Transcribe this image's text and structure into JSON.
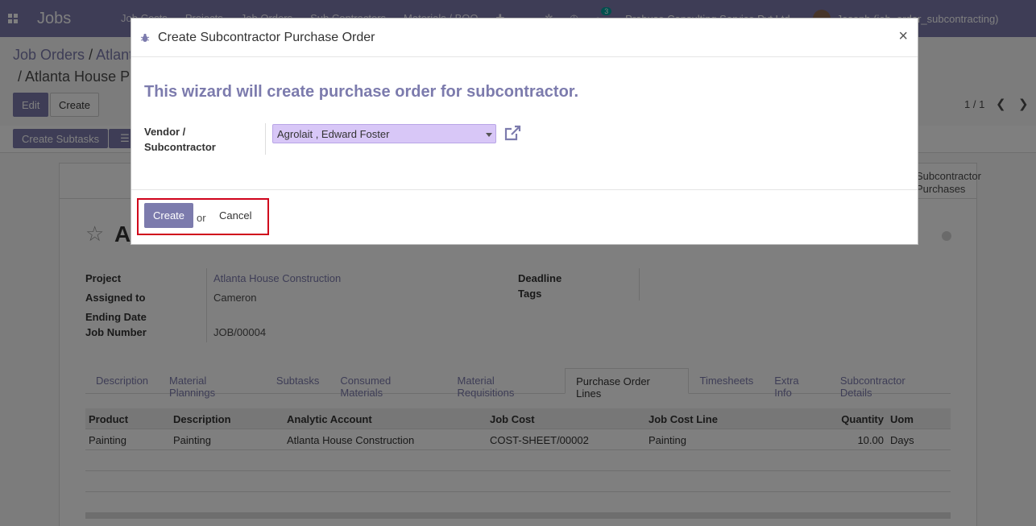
{
  "navbar": {
    "brand": "Jobs",
    "menu": [
      "Job Costs",
      "Projects",
      "Job Orders",
      "Sub Contractors",
      "Materials / BOQ"
    ],
    "chat_count": "3",
    "company": "Probuse Consulting Service Pvt Ltd",
    "user": "Joseph (job_order_subcontracting)"
  },
  "control_panel": {
    "breadcrumb_root": "Job Orders",
    "breadcrumb_mid": "Atlanta House Construction",
    "breadcrumb_current": "Atlanta House P",
    "edit_label": "Edit",
    "create_label": "Create",
    "pager": "1 / 1",
    "subtask_label": "Create Subtasks"
  },
  "sheet": {
    "smart_button": "Subcontractor Purchases",
    "title": "A",
    "fields": {
      "project_label": "Project",
      "project_value": "Atlanta House Construction",
      "assigned_label": "Assigned to",
      "assigned_value": "Cameron",
      "ending_label": "Ending Date",
      "job_number_label": "Job Number",
      "job_number_value": "JOB/00004",
      "deadline_label": "Deadline",
      "tags_label": "Tags"
    },
    "tabs": [
      "Description",
      "Material Plannings",
      "Subtasks",
      "Consumed Materials",
      "Material Requisitions",
      "Purchase Order Lines",
      "Timesheets",
      "Extra Info",
      "Subcontractor Details"
    ],
    "active_tab": "Purchase Order Lines",
    "table": {
      "headers": [
        "Product",
        "Description",
        "Analytic Account",
        "Job Cost",
        "Job Cost Line",
        "Quantity",
        "Uom"
      ],
      "rows": [
        [
          "Painting",
          "Painting",
          "Atlanta House Construction",
          "COST-SHEET/00002",
          "Painting",
          "10.00",
          "Days"
        ]
      ]
    }
  },
  "modal": {
    "title": "Create Subcontractor Purchase Order",
    "heading": "This wizard will create purchase order for subcontractor.",
    "vendor_label_1": "Vendor /",
    "vendor_label_2": "Subcontractor",
    "vendor_value": "Agrolait , Edward Foster",
    "create_label": "Create",
    "or_text": "or",
    "cancel_label": "Cancel"
  },
  "colors": {
    "brand": "#7c7bad",
    "highlight": "#d0021b",
    "select_bg": "#d8c7f7"
  }
}
